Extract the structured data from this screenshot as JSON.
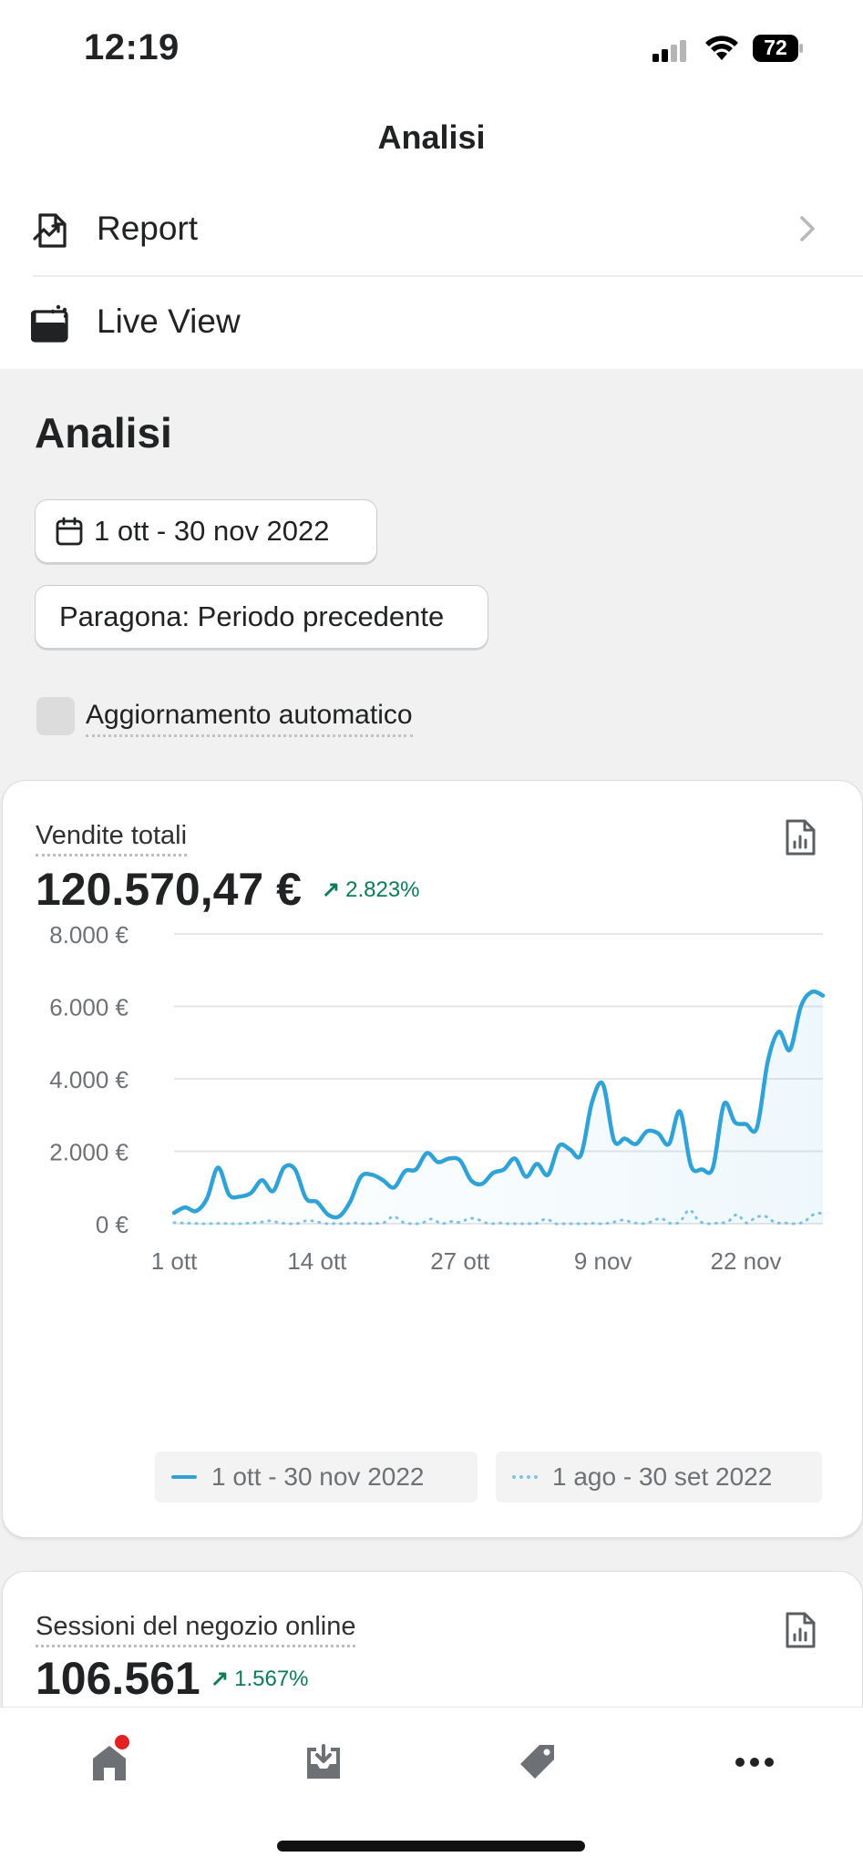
{
  "status_bar": {
    "time": "12:19",
    "battery": "72"
  },
  "header": {
    "title": "Analisi"
  },
  "menu": {
    "items": [
      {
        "label": "Report",
        "icon": "report-chart-icon"
      },
      {
        "label": "Live View",
        "icon": "live-view-icon"
      }
    ]
  },
  "main": {
    "title": "Analisi",
    "date_range": "1 ott - 30 nov 2022",
    "compare": "Paragona: Periodo precedente",
    "auto_refresh_label": "Aggiornamento automatico"
  },
  "sales_card": {
    "label": "Vendite totali",
    "value": "120.570,47 €",
    "change": "2.823%"
  },
  "sessions_card": {
    "label": "Sessioni del negozio online",
    "value": "106.561",
    "change": "1.567%"
  },
  "tabs": [
    {
      "icon": "home-icon",
      "badge": true
    },
    {
      "icon": "orders-inbox-icon"
    },
    {
      "icon": "tag-icon"
    },
    {
      "icon": "more-icon"
    }
  ],
  "colors": {
    "accent": "#2fa3d8",
    "positive": "#0a7d55",
    "badge": "#e22120"
  },
  "chart_data": {
    "type": "line",
    "ylim": [
      0,
      8000
    ],
    "y_ticks": [
      "0 €",
      "2.000 €",
      "4.000 €",
      "6.000 €",
      "8.000 €"
    ],
    "x_tick_labels": [
      {
        "day": 1,
        "label": "1 ott"
      },
      {
        "day": 14,
        "label": "14 ott"
      },
      {
        "day": 27,
        "label": "27 ott"
      },
      {
        "day": 40,
        "label": "9 nov"
      },
      {
        "day": 53,
        "label": "22 nov"
      }
    ],
    "series": [
      {
        "name": "1 ott - 30 nov 2022",
        "style": "solid",
        "values": [
          300,
          450,
          350,
          700,
          1550,
          800,
          750,
          850,
          1200,
          900,
          1550,
          1500,
          700,
          600,
          250,
          200,
          600,
          1300,
          1350,
          1200,
          1000,
          1450,
          1500,
          1950,
          1700,
          1800,
          1750,
          1200,
          1100,
          1400,
          1500,
          1800,
          1300,
          1650,
          1350,
          2150,
          2050,
          1900,
          3350,
          3850,
          2300,
          2350,
          2200,
          2550,
          2500,
          2200,
          3100,
          1600,
          1500,
          1550,
          3300,
          2800,
          2750,
          2650,
          4500,
          5300,
          4800,
          6000,
          6400,
          6300
        ]
      },
      {
        "name": "1 ago - 30 set 2022",
        "style": "dotted",
        "values": [
          30,
          20,
          10,
          0,
          5,
          10,
          0,
          0,
          20,
          40,
          80,
          30,
          0,
          10,
          90,
          50,
          0,
          5,
          0,
          20,
          0,
          10,
          30,
          200,
          40,
          0,
          20,
          130,
          0,
          60,
          40,
          150,
          100,
          0,
          20,
          0,
          0,
          0,
          10,
          130,
          0,
          0,
          0,
          0,
          10,
          0,
          40,
          100,
          40,
          0,
          50,
          150,
          10,
          50,
          380,
          80,
          0,
          20,
          50,
          250,
          20,
          180,
          200,
          30,
          20,
          0,
          50,
          250,
          300
        ]
      }
    ]
  }
}
